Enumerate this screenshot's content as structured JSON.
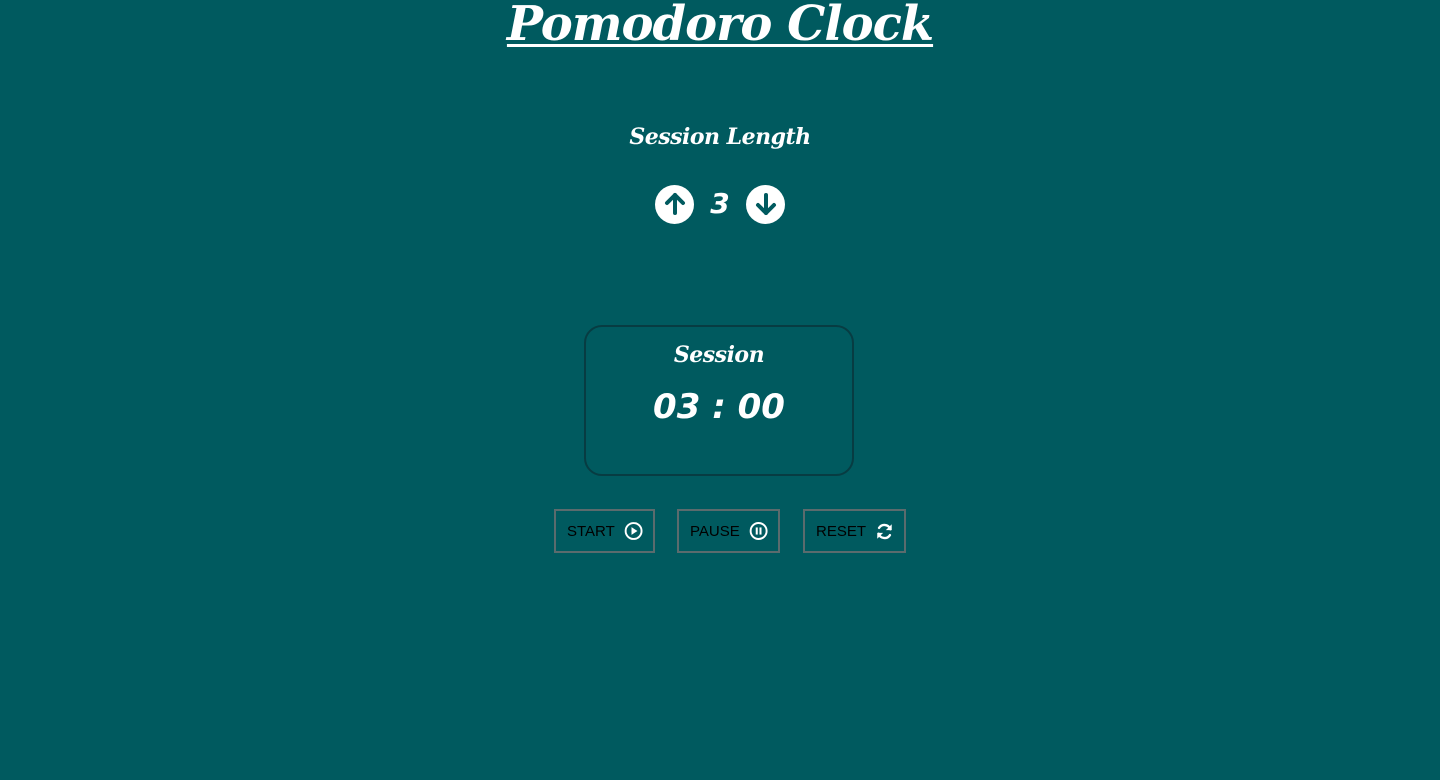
{
  "app": {
    "title": "Pomodoro Clock"
  },
  "session_length": {
    "label": "Session Length",
    "value": "3",
    "increment_icon": "arrow-up-circle-icon",
    "decrement_icon": "arrow-down-circle-icon"
  },
  "timer": {
    "label": "Session",
    "display": "03 : 00"
  },
  "buttons": {
    "start": {
      "label": "START",
      "icon": "play-circle-icon"
    },
    "pause": {
      "label": "PAUSE",
      "icon": "pause-circle-icon"
    },
    "reset": {
      "label": "RESET",
      "icon": "refresh-icon"
    }
  },
  "colors": {
    "background": "#005a5f",
    "text": "#ffffff",
    "timer_border": "#073c42",
    "button_border": "#5b6b6d"
  }
}
